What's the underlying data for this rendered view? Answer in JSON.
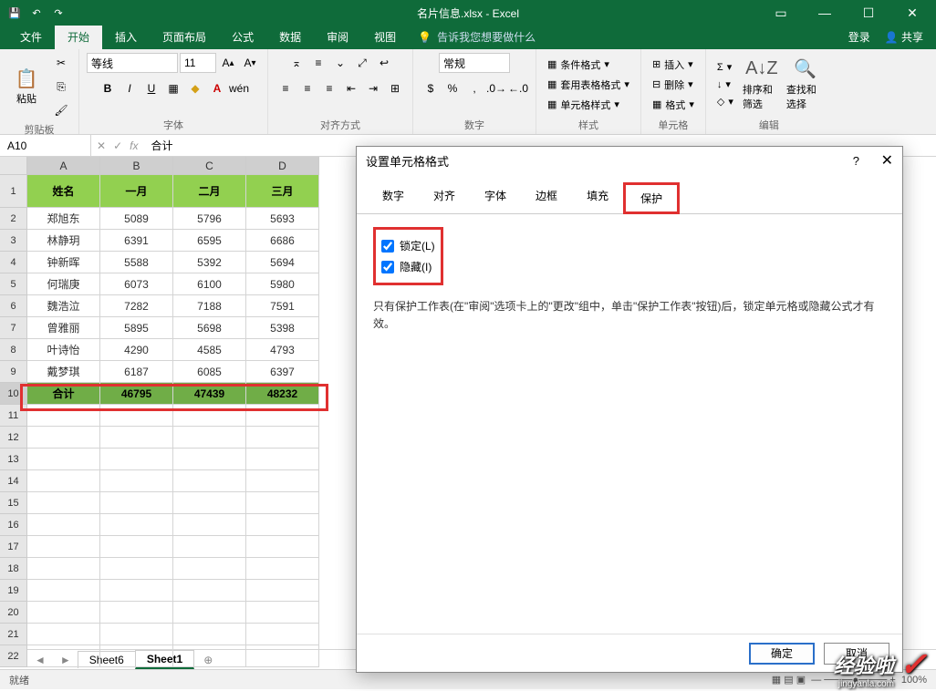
{
  "titlebar": {
    "title": "名片信息.xlsx - Excel",
    "help_icon": "?"
  },
  "ribbon": {
    "tabs": [
      "文件",
      "开始",
      "插入",
      "页面布局",
      "公式",
      "数据",
      "审阅",
      "视图"
    ],
    "active_tab": "开始",
    "tell_me": "告诉我您想要做什么",
    "login": "登录",
    "share": "共享",
    "groups": {
      "clipboard": {
        "paste": "粘贴",
        "label": "剪贴板"
      },
      "font": {
        "name": "等线",
        "size": "11",
        "label": "字体"
      },
      "alignment": {
        "label": "对齐方式"
      },
      "number": {
        "format": "常规",
        "label": "数字"
      },
      "styles": {
        "conditional": "条件格式",
        "table_format": "套用表格格式",
        "cell_style": "单元格样式",
        "label": "样式"
      },
      "cells": {
        "insert": "插入",
        "delete": "删除",
        "format": "格式",
        "label": "单元格"
      },
      "editing": {
        "sort_filter": "排序和筛选",
        "find_select": "查找和选择",
        "label": "编辑"
      }
    }
  },
  "formula_bar": {
    "name_box": "A10",
    "fx": "fx",
    "formula": "合计"
  },
  "sheet": {
    "columns": [
      "A",
      "B",
      "C",
      "D"
    ],
    "header_row": [
      "姓名",
      "一月",
      "二月",
      "三月"
    ],
    "rows": [
      [
        "郑旭东",
        "5089",
        "5796",
        "5693"
      ],
      [
        "林静玥",
        "6391",
        "6595",
        "6686"
      ],
      [
        "钟新晖",
        "5588",
        "5392",
        "5694"
      ],
      [
        "何瑞庚",
        "6073",
        "6100",
        "5980"
      ],
      [
        "魏浩泣",
        "7282",
        "7188",
        "7591"
      ],
      [
        "曾雅丽",
        "5895",
        "5698",
        "5398"
      ],
      [
        "叶诗怡",
        "4290",
        "4585",
        "4793"
      ],
      [
        "戴梦琪",
        "6187",
        "6085",
        "6397"
      ]
    ],
    "total_row": [
      "合计",
      "46795",
      "47439",
      "48232"
    ]
  },
  "sheet_tabs": {
    "tabs": [
      "Sheet6",
      "Sheet1"
    ],
    "active": "Sheet1"
  },
  "statusbar": {
    "ready": "就绪",
    "zoom": "100%"
  },
  "dialog": {
    "title": "设置单元格格式",
    "help": "?",
    "close": "✕",
    "tabs": [
      "数字",
      "对齐",
      "字体",
      "边框",
      "填充",
      "保护"
    ],
    "active_tab": "保护",
    "lock": "锁定(L)",
    "hide": "隐藏(I)",
    "note": "只有保护工作表(在\"审阅\"选项卡上的\"更改\"组中，单击\"保护工作表\"按钮)后，锁定单元格或隐藏公式才有效。",
    "ok": "确定",
    "cancel": "取消"
  },
  "watermark": {
    "text": "经验啦",
    "url": "jingyanla.com"
  }
}
